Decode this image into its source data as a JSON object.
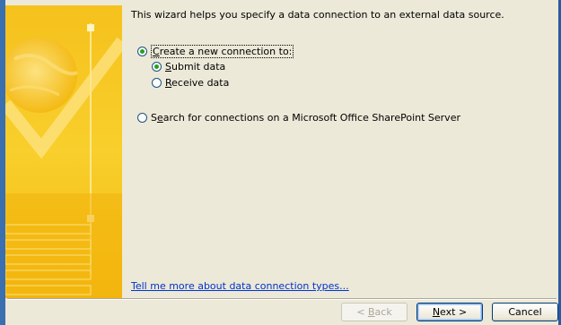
{
  "wizard": {
    "intro_text": "This wizard helps you specify a data connection to an external data source.",
    "options": {
      "create_new": {
        "label_accel": "C",
        "label_rest": "reate a new connection to:",
        "checked": true
      },
      "submit": {
        "label_accel": "S",
        "label_rest": "ubmit data",
        "checked": true
      },
      "receive": {
        "label_accel": "R",
        "label_rest": "eceive data",
        "checked": false
      },
      "search_pre": "S",
      "search_accel": "e",
      "search_rest": "arch for connections on a Microsoft Office SharePoint Server"
    },
    "help_link": {
      "accel": "T",
      "rest": "ell me more about data connection types..."
    }
  },
  "buttons": {
    "back": {
      "pre": "< ",
      "accel": "B",
      "rest": "ack"
    },
    "next": {
      "accel": "N",
      "rest": "ext >"
    },
    "cancel": "Cancel"
  },
  "colors": {
    "accent": "#21a121",
    "link": "#0033cc",
    "banner": "#f7c520"
  }
}
